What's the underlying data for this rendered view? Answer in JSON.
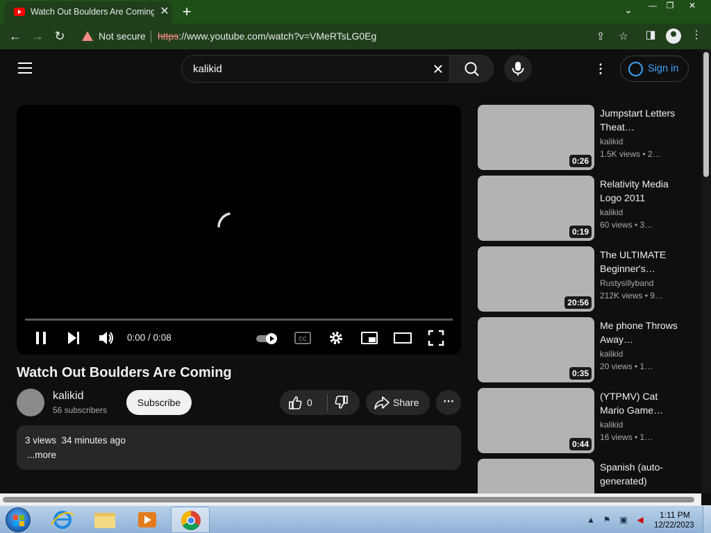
{
  "browser": {
    "tab_title": "Watch Out Boulders Are Coming",
    "security_label": "Not secure",
    "url_scheme": "https",
    "url_rest": "://www.youtube.com/watch?v=VMeRTsLG0Eg"
  },
  "masthead": {
    "search_query": "kalikid",
    "signin_label": "Sign in"
  },
  "player": {
    "time_display": "0:00 / 0:08",
    "progress": 0,
    "autoplay": true
  },
  "video": {
    "title": "Watch Out Boulders Are Coming",
    "channel": "kalikid",
    "subscribers": "56 subscribers",
    "subscribe_label": "Subscribe",
    "likes": "0",
    "share_label": "Share",
    "description_line": "3 views  34 minutes ago",
    "more_label": "...more"
  },
  "recommendations": [
    {
      "title": "Jumpstart Letters Theat…",
      "channel": "kalikid",
      "meta": "1.5K views  • 2…",
      "duration": "0:26"
    },
    {
      "title": "Relativity Media Logo 2011",
      "channel": "kalikid",
      "meta": "60 views  • 3…",
      "duration": "0:19"
    },
    {
      "title": "The ULTIMATE Beginner's…",
      "channel": "Rustysillyband",
      "meta": "212K views  • 9…",
      "duration": "20:56"
    },
    {
      "title": "Me phone Throws Away…",
      "channel": "kalikid",
      "meta": "20 views  • 1…",
      "duration": "0:35"
    },
    {
      "title": "(YTPMV) Cat Mario Game…",
      "channel": "kalikid",
      "meta": "16 views  • 1…",
      "duration": "0:44"
    },
    {
      "title": "Spanish (auto-generated)",
      "channel": "",
      "meta": "",
      "duration": ""
    }
  ],
  "taskbar": {
    "time": "1:11 PM",
    "date": "12/22/2023"
  },
  "colors": {
    "chrome_frame": "#1e4f17",
    "yt_background": "#0f0f0f",
    "link_blue": "#3ea6ff",
    "youtube_red": "#ff0000"
  }
}
